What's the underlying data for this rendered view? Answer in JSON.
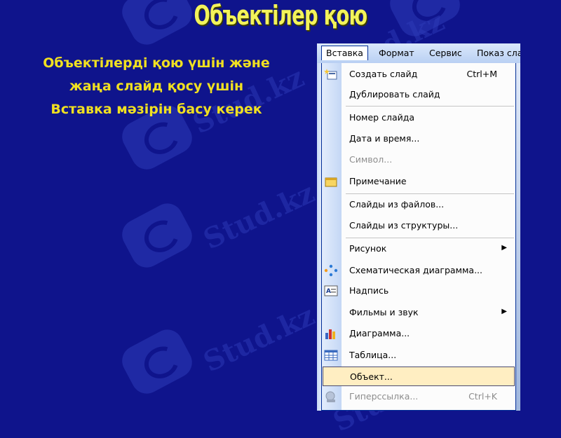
{
  "slide": {
    "title": "Объектілер қою",
    "description_lines": [
      "Объектілерді қою үшін және",
      "жаңа слайд қосу үшін",
      "Вставка мәзірін басу керек"
    ],
    "watermark": "Stud.kz"
  },
  "menubar": {
    "items": [
      "Вставка",
      "Формат",
      "Сервис",
      "Показ сла"
    ]
  },
  "menu": {
    "items": [
      {
        "label": "Создать слайд",
        "shortcut": "Ctrl+M",
        "icon": "new-slide-icon"
      },
      {
        "label": "Дублировать слайд"
      },
      {
        "label": "Номер слайда"
      },
      {
        "label": "Дата и время..."
      },
      {
        "label": "Символ...",
        "disabled": true
      },
      {
        "label": "Примечание",
        "icon": "note-icon"
      },
      {
        "label": "Слайды из файлов..."
      },
      {
        "label": "Слайды из структуры..."
      },
      {
        "label": "Рисунок",
        "submenu": true
      },
      {
        "label": "Схематическая диаграмма...",
        "icon": "diagram-icon"
      },
      {
        "label": "Надпись",
        "icon": "textbox-icon"
      },
      {
        "label": "Фильмы и звук",
        "submenu": true
      },
      {
        "label": "Диаграмма...",
        "icon": "chart-icon"
      },
      {
        "label": "Таблица...",
        "icon": "table-icon"
      },
      {
        "label": "Объект...",
        "highlighted": true
      },
      {
        "label": "Гиперссылка...",
        "shortcut": "Ctrl+K",
        "disabled": true,
        "icon": "hyperlink-icon"
      }
    ]
  },
  "colors": {
    "background": "#0f148c",
    "title": "#f3f35a",
    "text": "#f0e021",
    "highlight": "#ffeec2"
  }
}
